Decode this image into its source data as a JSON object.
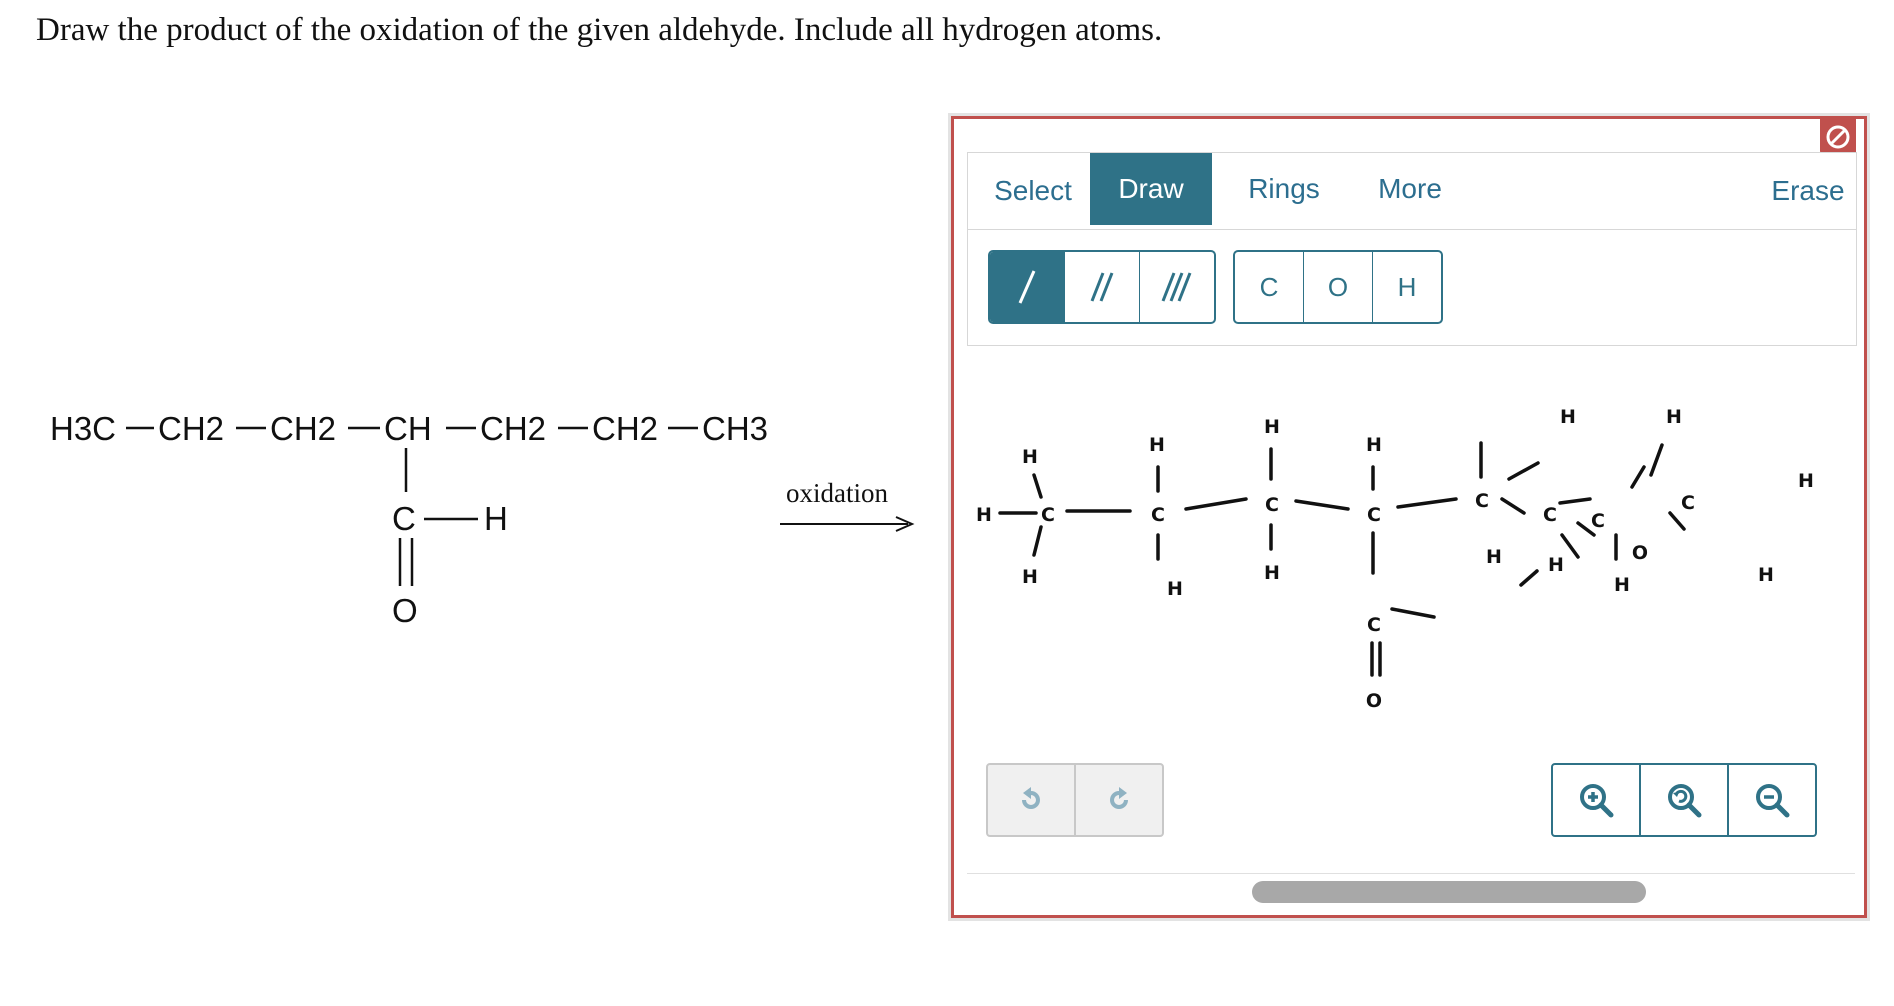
{
  "question": "Draw the product of the oxidation of the given aldehyde. Include all hydrogen atoms.",
  "reactant": {
    "main_chain": [
      "H3C",
      "CH2",
      "CH2",
      "CH",
      "CH2",
      "CH2",
      "CH3"
    ],
    "branch_atom": "C",
    "branch_h": "H",
    "branch_o": "O"
  },
  "arrow_label": "oxidation",
  "editor": {
    "tabs": {
      "select": "Select",
      "draw": "Draw",
      "rings": "Rings",
      "more": "More",
      "erase": "Erase"
    },
    "active_tab": "Draw",
    "bond_buttons": [
      "/",
      "//",
      "///"
    ],
    "atom_buttons": [
      "C",
      "O",
      "H"
    ],
    "history": [
      "undo-icon",
      "redo-icon"
    ],
    "zoom": [
      "zoom-in-icon",
      "zoom-reset-icon",
      "zoom-out-icon"
    ],
    "accent": "#2f7287",
    "border_color": "#c0504d"
  },
  "drawing": {
    "atoms": [
      {
        "label": "H"
      },
      {
        "label": "C"
      },
      {
        "label": "H"
      },
      {
        "label": "H"
      },
      {
        "label": "C"
      },
      {
        "label": "H"
      },
      {
        "label": "H"
      },
      {
        "label": "C"
      },
      {
        "label": "H"
      },
      {
        "label": "H"
      },
      {
        "label": "C"
      },
      {
        "label": "H"
      },
      {
        "label": "C"
      },
      {
        "label": "O"
      },
      {
        "label": "C"
      },
      {
        "label": "C"
      },
      {
        "label": "H"
      },
      {
        "label": "C"
      },
      {
        "label": "H"
      },
      {
        "label": "H"
      },
      {
        "label": "O"
      },
      {
        "label": "H"
      },
      {
        "label": "C"
      },
      {
        "label": "H"
      },
      {
        "label": "H"
      },
      {
        "label": "H"
      }
    ]
  }
}
